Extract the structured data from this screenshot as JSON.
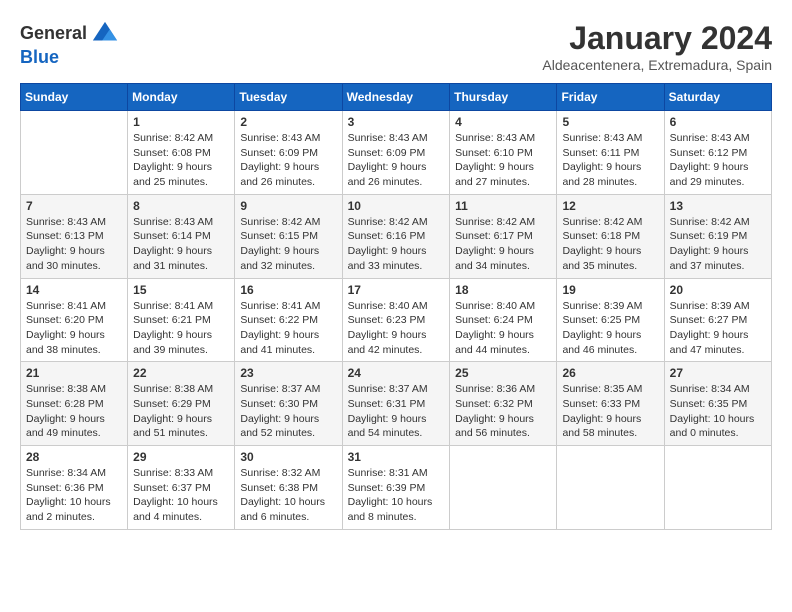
{
  "header": {
    "logo_general": "General",
    "logo_blue": "Blue",
    "title": "January 2024",
    "location": "Aldeacentenera, Extremadura, Spain"
  },
  "days_of_week": [
    "Sunday",
    "Monday",
    "Tuesday",
    "Wednesday",
    "Thursday",
    "Friday",
    "Saturday"
  ],
  "weeks": [
    [
      {
        "day": "",
        "info": ""
      },
      {
        "day": "1",
        "info": "Sunrise: 8:42 AM\nSunset: 6:08 PM\nDaylight: 9 hours\nand 25 minutes."
      },
      {
        "day": "2",
        "info": "Sunrise: 8:43 AM\nSunset: 6:09 PM\nDaylight: 9 hours\nand 26 minutes."
      },
      {
        "day": "3",
        "info": "Sunrise: 8:43 AM\nSunset: 6:09 PM\nDaylight: 9 hours\nand 26 minutes."
      },
      {
        "day": "4",
        "info": "Sunrise: 8:43 AM\nSunset: 6:10 PM\nDaylight: 9 hours\nand 27 minutes."
      },
      {
        "day": "5",
        "info": "Sunrise: 8:43 AM\nSunset: 6:11 PM\nDaylight: 9 hours\nand 28 minutes."
      },
      {
        "day": "6",
        "info": "Sunrise: 8:43 AM\nSunset: 6:12 PM\nDaylight: 9 hours\nand 29 minutes."
      }
    ],
    [
      {
        "day": "7",
        "info": "Sunrise: 8:43 AM\nSunset: 6:13 PM\nDaylight: 9 hours\nand 30 minutes."
      },
      {
        "day": "8",
        "info": "Sunrise: 8:43 AM\nSunset: 6:14 PM\nDaylight: 9 hours\nand 31 minutes."
      },
      {
        "day": "9",
        "info": "Sunrise: 8:42 AM\nSunset: 6:15 PM\nDaylight: 9 hours\nand 32 minutes."
      },
      {
        "day": "10",
        "info": "Sunrise: 8:42 AM\nSunset: 6:16 PM\nDaylight: 9 hours\nand 33 minutes."
      },
      {
        "day": "11",
        "info": "Sunrise: 8:42 AM\nSunset: 6:17 PM\nDaylight: 9 hours\nand 34 minutes."
      },
      {
        "day": "12",
        "info": "Sunrise: 8:42 AM\nSunset: 6:18 PM\nDaylight: 9 hours\nand 35 minutes."
      },
      {
        "day": "13",
        "info": "Sunrise: 8:42 AM\nSunset: 6:19 PM\nDaylight: 9 hours\nand 37 minutes."
      }
    ],
    [
      {
        "day": "14",
        "info": "Sunrise: 8:41 AM\nSunset: 6:20 PM\nDaylight: 9 hours\nand 38 minutes."
      },
      {
        "day": "15",
        "info": "Sunrise: 8:41 AM\nSunset: 6:21 PM\nDaylight: 9 hours\nand 39 minutes."
      },
      {
        "day": "16",
        "info": "Sunrise: 8:41 AM\nSunset: 6:22 PM\nDaylight: 9 hours\nand 41 minutes."
      },
      {
        "day": "17",
        "info": "Sunrise: 8:40 AM\nSunset: 6:23 PM\nDaylight: 9 hours\nand 42 minutes."
      },
      {
        "day": "18",
        "info": "Sunrise: 8:40 AM\nSunset: 6:24 PM\nDaylight: 9 hours\nand 44 minutes."
      },
      {
        "day": "19",
        "info": "Sunrise: 8:39 AM\nSunset: 6:25 PM\nDaylight: 9 hours\nand 46 minutes."
      },
      {
        "day": "20",
        "info": "Sunrise: 8:39 AM\nSunset: 6:27 PM\nDaylight: 9 hours\nand 47 minutes."
      }
    ],
    [
      {
        "day": "21",
        "info": "Sunrise: 8:38 AM\nSunset: 6:28 PM\nDaylight: 9 hours\nand 49 minutes."
      },
      {
        "day": "22",
        "info": "Sunrise: 8:38 AM\nSunset: 6:29 PM\nDaylight: 9 hours\nand 51 minutes."
      },
      {
        "day": "23",
        "info": "Sunrise: 8:37 AM\nSunset: 6:30 PM\nDaylight: 9 hours\nand 52 minutes."
      },
      {
        "day": "24",
        "info": "Sunrise: 8:37 AM\nSunset: 6:31 PM\nDaylight: 9 hours\nand 54 minutes."
      },
      {
        "day": "25",
        "info": "Sunrise: 8:36 AM\nSunset: 6:32 PM\nDaylight: 9 hours\nand 56 minutes."
      },
      {
        "day": "26",
        "info": "Sunrise: 8:35 AM\nSunset: 6:33 PM\nDaylight: 9 hours\nand 58 minutes."
      },
      {
        "day": "27",
        "info": "Sunrise: 8:34 AM\nSunset: 6:35 PM\nDaylight: 10 hours\nand 0 minutes."
      }
    ],
    [
      {
        "day": "28",
        "info": "Sunrise: 8:34 AM\nSunset: 6:36 PM\nDaylight: 10 hours\nand 2 minutes."
      },
      {
        "day": "29",
        "info": "Sunrise: 8:33 AM\nSunset: 6:37 PM\nDaylight: 10 hours\nand 4 minutes."
      },
      {
        "day": "30",
        "info": "Sunrise: 8:32 AM\nSunset: 6:38 PM\nDaylight: 10 hours\nand 6 minutes."
      },
      {
        "day": "31",
        "info": "Sunrise: 8:31 AM\nSunset: 6:39 PM\nDaylight: 10 hours\nand 8 minutes."
      },
      {
        "day": "",
        "info": ""
      },
      {
        "day": "",
        "info": ""
      },
      {
        "day": "",
        "info": ""
      }
    ]
  ]
}
